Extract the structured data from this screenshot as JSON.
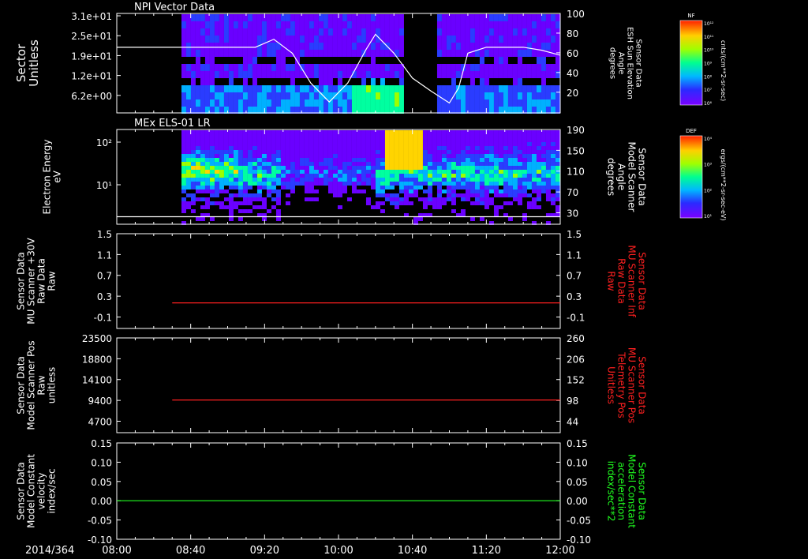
{
  "figure": {
    "date": "2014/364",
    "time_ticks": [
      "08:00",
      "08:40",
      "09:20",
      "10:00",
      "10:40",
      "11:20",
      "12:00"
    ]
  },
  "colorbars": [
    {
      "title": "NF",
      "units": "cnts/(cm**2-sr-sec)",
      "tick_labels": [
        "10¹²",
        "10¹¹",
        "10¹⁰",
        "10⁹",
        "10⁸",
        "10⁷",
        "10⁶"
      ]
    },
    {
      "title": "DEF",
      "units": "ergs/(cm**2-sr-sec-eV)",
      "tick_labels": [
        "10⁴",
        "10³",
        "10²",
        "10¹"
      ]
    }
  ],
  "chart_data": [
    {
      "type": "heatmap",
      "title": "NPI Vector Data",
      "ylabel": "Sector\nUnitless",
      "yticks": [
        "3.1e+01",
        "2.5e+01",
        "1.9e+01",
        "1.2e+01",
        "6.2e+00"
      ],
      "y2label": "Sensor Data\nESH Sun Elevation\nAngle\ndegrees",
      "y2ticks": [
        "100",
        "80",
        "60",
        "40",
        "20"
      ],
      "y2lim": [
        0,
        100
      ],
      "overlay_series": {
        "name": "Sun Elevation Angle",
        "color": "#ffffff",
        "x": [
          "08:00",
          "08:20",
          "08:40",
          "09:00",
          "09:15",
          "09:25",
          "09:35",
          "09:45",
          "09:55",
          "10:05",
          "10:15",
          "10:20",
          "10:30",
          "10:40",
          "10:50",
          "11:00",
          "11:05",
          "11:10",
          "11:20",
          "11:30",
          "11:40",
          "11:50",
          "12:00"
        ],
        "y": [
          66,
          66,
          66,
          66,
          66,
          74,
          60,
          30,
          11,
          30,
          64,
          79,
          60,
          35,
          22,
          10,
          25,
          60,
          66,
          66,
          66,
          63,
          58
        ]
      },
      "data_gap": {
        "from": "10:36",
        "to": "10:52"
      },
      "data_start": "08:35"
    },
    {
      "type": "heatmap",
      "title": "MEx ELS-01 LR",
      "ylabel": "Electron Energy\neV",
      "yticks": [
        "10²",
        "10¹"
      ],
      "y2label": "Sensor Data\nModel Scanner\nAngle\ndegrees",
      "y2ticks": [
        "190",
        "150",
        "110",
        "70",
        "30"
      ],
      "y2lim": [
        0,
        190
      ],
      "overlay_series": {
        "name": "Scanner Angle",
        "color": "#ffffff",
        "x": [
          "08:00",
          "12:00"
        ],
        "y": [
          15,
          15
        ]
      },
      "data_start": "08:35"
    },
    {
      "type": "line",
      "ylabel": "Sensor Data\nMU Scanner +30V\nRaw Data\nRaw",
      "yticks": [
        "1.5",
        "1.1",
        "0.7",
        "0.3",
        "-0.1"
      ],
      "ylim": [
        -0.5,
        1.5
      ],
      "y2label": "Sensor Data\nMU Scanner Inf\nRaw Data\nRaw",
      "y2ticks": [
        "1.5",
        "1.1",
        "0.7",
        "0.3",
        "-0.1"
      ],
      "y2color": "#ff2020",
      "series": [
        {
          "color": "#ff2020",
          "x": [
            "08:30",
            "12:00"
          ],
          "y": [
            0.04,
            0.04
          ]
        }
      ]
    },
    {
      "type": "line",
      "ylabel": "Sensor Data\nModel Scanner Pos\nRaw\nunitless",
      "yticks": [
        "23500",
        "18800",
        "14100",
        "9400",
        "4700"
      ],
      "ylim": [
        0,
        23500
      ],
      "y2label": "Sensor Data\nMU Scanner Pos\nTelemetry Pos\nUnitless",
      "y2ticks": [
        "260",
        "206",
        "152",
        "98",
        "44"
      ],
      "y2color": "#ff2020",
      "series": [
        {
          "color": "#ff2020",
          "x": [
            "08:30",
            "12:00"
          ],
          "y": [
            8100,
            8100
          ]
        }
      ]
    },
    {
      "type": "line",
      "ylabel": "Sensor Data\nModel Constant\nvelocity\nindex/sec",
      "yticks": [
        "0.15",
        "0.10",
        "0.05",
        "0.00",
        "-0.05",
        "-0.10"
      ],
      "ylim": [
        -0.1,
        0.15
      ],
      "y2label": "Sensor Data\nModel Constant\nacceleration\nindex/sec**2",
      "y2ticks": [
        "0.15",
        "0.10",
        "0.05",
        "0.00",
        "-0.05",
        "-0.10"
      ],
      "y2color": "#20ff20",
      "series": [
        {
          "color": "#20ff20",
          "x": [
            "08:00",
            "12:00"
          ],
          "y": [
            0.0,
            0.0
          ]
        }
      ]
    }
  ]
}
